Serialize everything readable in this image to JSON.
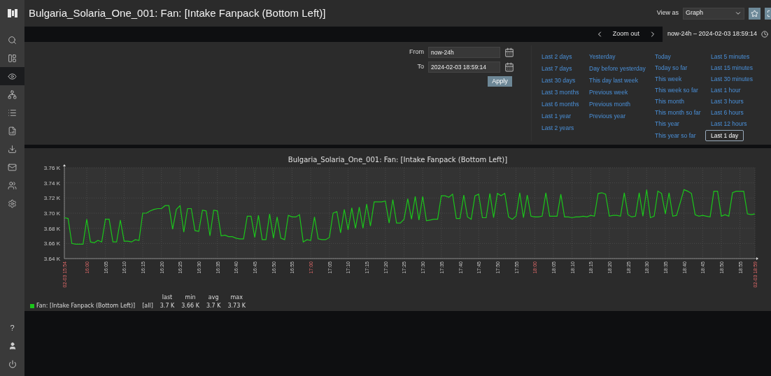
{
  "header": {
    "title": "Bulgaria_Solaria_One_001: Fan: [Intake Fanpack (Bottom Left)]",
    "view_as_label": "View as",
    "view_as_value": "Graph"
  },
  "sidebar": {
    "items": [
      {
        "kind": "search",
        "selected": false
      },
      {
        "kind": "dashboard",
        "selected": false
      },
      {
        "kind": "monitoring",
        "selected": true
      },
      {
        "kind": "hierarchy",
        "selected": false
      },
      {
        "kind": "list",
        "selected": false
      },
      {
        "kind": "report",
        "selected": false
      },
      {
        "kind": "download",
        "selected": false
      },
      {
        "kind": "mail",
        "selected": false
      },
      {
        "kind": "users",
        "selected": false
      },
      {
        "kind": "settings",
        "selected": false
      }
    ],
    "help_label": "?"
  },
  "time_nav": {
    "zoom_out": "Zoom out",
    "range": "now-24h – 2024-02-03 18:59:14"
  },
  "filter": {
    "from_label": "From",
    "from_value": "now-24h",
    "to_label": "To",
    "to_value": "2024-02-03 18:59:14",
    "apply": "Apply",
    "quick_ranges": [
      [
        {
          "label": "Last 2 days",
          "selected": false
        },
        {
          "label": "Last 7 days",
          "selected": false
        },
        {
          "label": "Last 30 days",
          "selected": false
        },
        {
          "label": "Last 3 months",
          "selected": false
        },
        {
          "label": "Last 6 months",
          "selected": false
        },
        {
          "label": "Last 1 year",
          "selected": false
        },
        {
          "label": "Last 2 years",
          "selected": false
        }
      ],
      [
        {
          "label": "Yesterday",
          "selected": false
        },
        {
          "label": "Day before yesterday",
          "selected": false
        },
        {
          "label": "This day last week",
          "selected": false
        },
        {
          "label": "Previous week",
          "selected": false
        },
        {
          "label": "Previous month",
          "selected": false
        },
        {
          "label": "Previous year",
          "selected": false
        }
      ],
      [
        {
          "label": "Today",
          "selected": false
        },
        {
          "label": "Today so far",
          "selected": false
        },
        {
          "label": "This week",
          "selected": false
        },
        {
          "label": "This week so far",
          "selected": false
        },
        {
          "label": "This month",
          "selected": false
        },
        {
          "label": "This month so far",
          "selected": false
        },
        {
          "label": "This year",
          "selected": false
        },
        {
          "label": "This year so far",
          "selected": false
        }
      ],
      [
        {
          "label": "Last 5 minutes",
          "selected": false
        },
        {
          "label": "Last 15 minutes",
          "selected": false
        },
        {
          "label": "Last 30 minutes",
          "selected": false
        },
        {
          "label": "Last 1 hour",
          "selected": false
        },
        {
          "label": "Last 3 hours",
          "selected": false
        },
        {
          "label": "Last 6 hours",
          "selected": false
        },
        {
          "label": "Last 12 hours",
          "selected": false
        },
        {
          "label": "Last 1 day",
          "selected": true
        }
      ]
    ]
  },
  "graph": {
    "title": "Bulgaria_Solaria_One_001: Fan: [Intake Fanpack (Bottom Left)]",
    "chart_data": {
      "type": "line",
      "categories": [
        "02-03 15:54",
        null,
        null,
        null,
        null,
        null,
        "16:00",
        null,
        null,
        null,
        null,
        "16:05",
        null,
        null,
        null,
        null,
        "16:10",
        null,
        null,
        null,
        null,
        "16:15",
        null,
        null,
        null,
        null,
        "16:20",
        null,
        null,
        null,
        null,
        "16:25",
        null,
        null,
        null,
        null,
        "16:30",
        null,
        null,
        null,
        null,
        "16:35",
        null,
        null,
        null,
        null,
        "16:40",
        null,
        null,
        null,
        null,
        "16:45",
        null,
        null,
        null,
        null,
        "16:50",
        null,
        null,
        null,
        null,
        "16:55",
        null,
        null,
        null,
        null,
        "17:00",
        null,
        null,
        null,
        null,
        "17:05",
        null,
        null,
        null,
        null,
        "17:10",
        null,
        null,
        null,
        null,
        "17:15",
        null,
        null,
        null,
        null,
        "17:20",
        null,
        null,
        null,
        null,
        "17:25",
        null,
        null,
        null,
        null,
        "17:30",
        null,
        null,
        null,
        null,
        "17:35",
        null,
        null,
        null,
        null,
        "17:40",
        null,
        null,
        null,
        null,
        "17:45",
        null,
        null,
        null,
        null,
        "17:50",
        null,
        null,
        null,
        null,
        "17:55",
        null,
        null,
        null,
        null,
        "18:00",
        null,
        null,
        null,
        null,
        "18:05",
        null,
        null,
        null,
        null,
        "18:10",
        null,
        null,
        null,
        null,
        "18:15",
        null,
        null,
        null,
        null,
        "18:20",
        null,
        null,
        null,
        null,
        "18:25",
        null,
        null,
        null,
        null,
        "18:30",
        null,
        null,
        null,
        null,
        "18:35",
        null,
        null,
        null,
        null,
        "18:40",
        null,
        null,
        null,
        null,
        "18:45",
        null,
        null,
        null,
        null,
        "18:50",
        null,
        null,
        null,
        null,
        "18:55",
        null,
        null,
        null,
        "02-03 18:59"
      ],
      "series": [
        {
          "name": "Fan: [Intake Fanpack (Bottom Left)]",
          "color": "#1bc61b",
          "values": [
            3.694,
            3.693,
            3.66,
            3.659,
            3.659,
            3.659,
            3.692,
            3.662,
            3.661,
            3.664,
            3.662,
            3.692,
            3.692,
            3.662,
            3.662,
            3.691,
            3.663,
            3.663,
            3.662,
            3.665,
            3.664,
            3.7,
            3.7,
            3.703,
            3.705,
            3.706,
            3.706,
            3.71,
            3.71,
            3.679,
            3.705,
            3.71,
            3.675,
            3.706,
            3.706,
            3.677,
            3.676,
            3.704,
            3.703,
            3.67,
            3.704,
            3.703,
            3.67,
            3.671,
            3.669,
            3.669,
            3.667,
            3.666,
            3.666,
            3.696,
            3.696,
            3.668,
            3.697,
            3.665,
            3.665,
            3.699,
            3.667,
            3.695,
            3.667,
            3.665,
            3.697,
            3.695,
            3.695,
            3.698,
            3.662,
            3.665,
            3.664,
            3.695,
            3.666,
            3.665,
            3.665,
            3.668,
            3.7,
            3.702,
            3.674,
            3.705,
            3.678,
            3.707,
            3.68,
            3.708,
            3.68,
            3.712,
            3.683,
            3.715,
            3.715,
            3.715,
            3.716,
            3.687,
            3.718,
            3.687,
            3.687,
            3.692,
            3.719,
            3.692,
            3.722,
            3.691,
            3.722,
            3.69,
            3.691,
            3.692,
            3.692,
            3.723,
            3.723,
            3.721,
            3.725,
            3.693,
            3.693,
            3.724,
            3.695,
            3.692,
            3.723,
            3.725,
            3.694,
            3.694,
            3.726,
            3.694,
            3.726,
            3.723,
            3.726,
            3.695,
            3.692,
            3.696,
            3.727,
            3.694,
            3.724,
            3.696,
            3.695,
            3.695,
            3.696,
            3.727,
            3.696,
            3.696,
            3.696,
            3.725,
            3.695,
            3.695,
            3.694,
            3.695,
            3.695,
            3.696,
            3.695,
            3.697,
            3.696,
            3.726,
            3.727,
            3.725,
            3.696,
            3.697,
            3.697,
            3.696,
            3.727,
            3.698,
            3.695,
            3.696,
            3.727,
            3.696,
            3.731,
            3.694,
            3.696,
            3.729,
            3.726,
            3.699,
            3.727,
            3.696,
            3.697,
            3.714,
            3.731,
            3.729,
            3.726,
            3.698,
            3.696,
            3.697,
            3.696,
            3.695,
            3.729,
            3.729,
            3.696,
            3.698,
            3.696,
            3.727,
            3.729,
            3.729,
            3.729,
            3.699,
            3.698,
            3.699
          ]
        }
      ],
      "grid": true,
      "ylim": [
        3.64,
        3.76
      ],
      "yticks": [
        {
          "value": 3.64,
          "label": "3.64 K"
        },
        {
          "value": 3.66,
          "label": "3.66 K"
        },
        {
          "value": 3.68,
          "label": "3.68 K"
        },
        {
          "value": 3.7,
          "label": "3.70 K"
        },
        {
          "value": 3.72,
          "label": "3.72 K"
        },
        {
          "value": 3.74,
          "label": "3.74 K"
        },
        {
          "value": 3.76,
          "label": "3.76 K"
        }
      ]
    },
    "legend": {
      "scope": "[all]",
      "stats": [
        {
          "label": "last",
          "value": "3.7 K"
        },
        {
          "label": "min",
          "value": "3.66 K"
        },
        {
          "label": "avg",
          "value": "3.7 K"
        },
        {
          "label": "max",
          "value": "3.73 K"
        }
      ]
    }
  }
}
